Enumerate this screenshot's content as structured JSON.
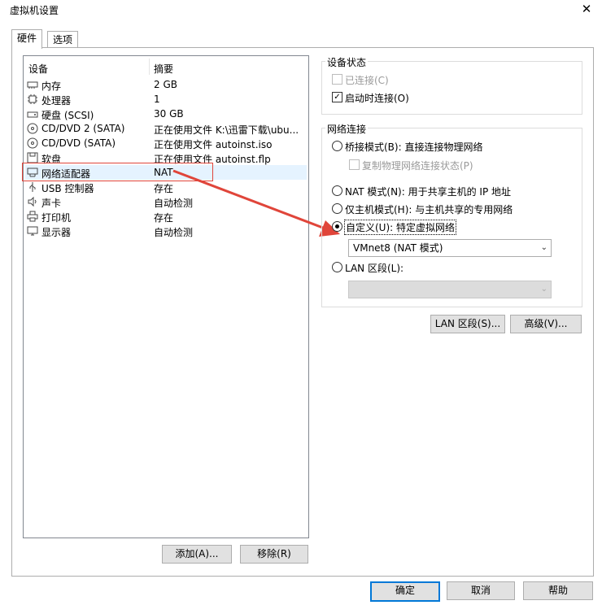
{
  "window": {
    "title": "虚拟机设置",
    "close_glyph": "✕"
  },
  "tabs": [
    {
      "label": "硬件"
    },
    {
      "label": "选项"
    }
  ],
  "devices": {
    "col_device": "设备",
    "col_summary": "摘要",
    "rows": [
      {
        "name": "内存",
        "summary": "2 GB",
        "icon": "memory-icon"
      },
      {
        "name": "处理器",
        "summary": "1",
        "icon": "cpu-icon"
      },
      {
        "name": "硬盘 (SCSI)",
        "summary": "30 GB",
        "icon": "hard-disk-icon"
      },
      {
        "name": "CD/DVD 2 (SATA)",
        "summary": "正在使用文件 K:\\迅雷下载\\ubu...",
        "icon": "cd-dvd-icon"
      },
      {
        "name": "CD/DVD (SATA)",
        "summary": "正在使用文件 autoinst.iso",
        "icon": "cd-dvd-icon"
      },
      {
        "name": "软盘",
        "summary": "正在使用文件 autoinst.flp",
        "icon": "floppy-icon"
      },
      {
        "name": "网络适配器",
        "summary": "NAT",
        "icon": "network-adapter-icon",
        "selected": true
      },
      {
        "name": "USB 控制器",
        "summary": "存在",
        "icon": "usb-icon"
      },
      {
        "name": "声卡",
        "summary": "自动检测",
        "icon": "speaker-icon"
      },
      {
        "name": "打印机",
        "summary": "存在",
        "icon": "printer-icon"
      },
      {
        "name": "显示器",
        "summary": "自动检测",
        "icon": "monitor-icon"
      }
    ],
    "add_button": "添加(A)...",
    "remove_button": "移除(R)"
  },
  "device_status": {
    "legend": "设备状态",
    "connected": {
      "label": "已连接(C)",
      "checked": false,
      "disabled": true
    },
    "connect_on_power_on": {
      "label": "启动时连接(O)",
      "checked": true
    }
  },
  "network": {
    "legend": "网络连接",
    "bridged": {
      "label": "桥接模式(B): 直接连接物理网络",
      "selected": false
    },
    "replicate": {
      "label": "复制物理网络连接状态(P)",
      "checked": false,
      "disabled": true
    },
    "nat": {
      "label": "NAT 模式(N): 用于共享主机的 IP 地址",
      "selected": false
    },
    "host_only": {
      "label": "仅主机模式(H): 与主机共享的专用网络",
      "selected": false
    },
    "custom": {
      "label": "自定义(U): 特定虚拟网络",
      "selected": true
    },
    "custom_select_value": "VMnet8 (NAT 模式)",
    "lan_segment": {
      "label": "LAN 区段(L):",
      "selected": false
    },
    "lan_select_value": ""
  },
  "action_buttons": {
    "lan_segments": "LAN 区段(S)...",
    "advanced": "高级(V)..."
  },
  "footer": {
    "ok": "确定",
    "cancel": "取消",
    "help": "帮助"
  },
  "colors": {
    "accent": "#0078d7",
    "annotation_red": "#e0453a",
    "selection": "#e5f3ff"
  }
}
